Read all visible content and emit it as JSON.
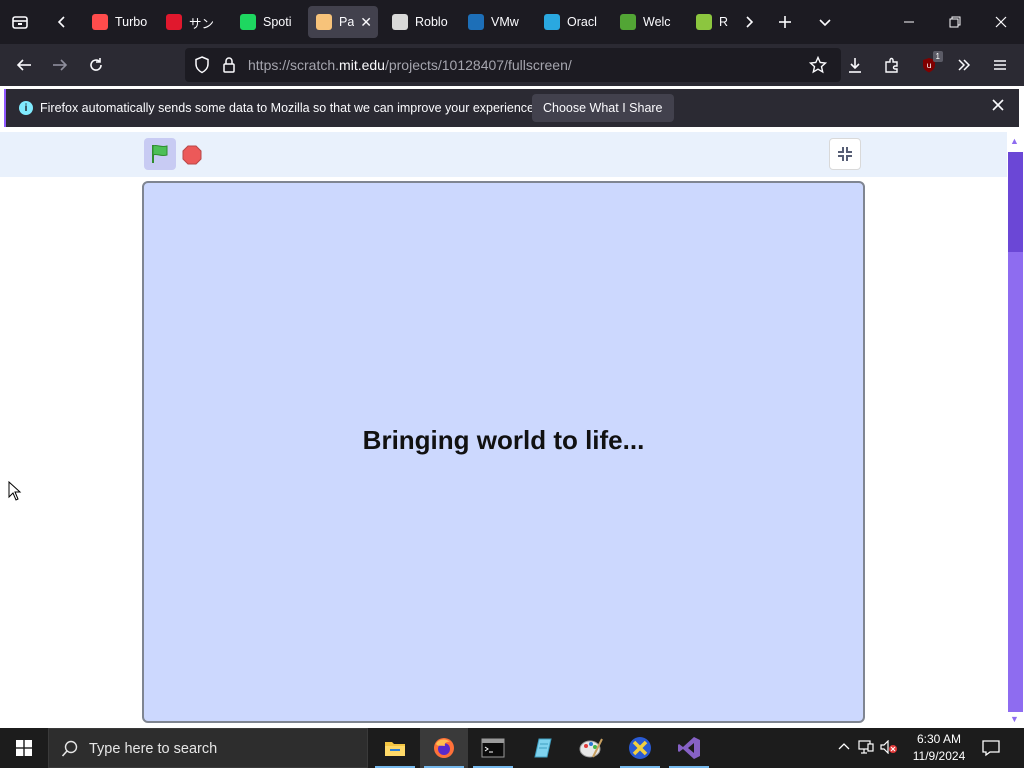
{
  "tabs": [
    {
      "label": "Turbo",
      "favicon": "turbowarp-icon",
      "color": "#ff4c4c"
    },
    {
      "label": "サン",
      "favicon": "sanrio-icon",
      "color": "#e0182d"
    },
    {
      "label": "Spoti",
      "favicon": "spotify-icon",
      "color": "#1ed760"
    },
    {
      "label": "Pa",
      "favicon": "scratch-page-icon",
      "color": "#f7c37a",
      "active": true
    },
    {
      "label": "Roblo",
      "favicon": "roblox-icon",
      "color": "#d9d9d9"
    },
    {
      "label": "VMw",
      "favicon": "vmware-icon",
      "color": "#1d6fb8"
    },
    {
      "label": "Oracl",
      "favicon": "oracle-icon",
      "color": "#2aa8e0"
    },
    {
      "label": "Welc",
      "favicon": "minecraft-icon",
      "color": "#52a535"
    },
    {
      "label": "Rol",
      "favicon": "roblox-studio-icon",
      "color": "#8cc63f"
    }
  ],
  "navbar": {
    "url_prefix": "https://scratch.",
    "url_host": "mit.edu",
    "url_suffix": "/projects/10128407/fullscreen/",
    "extension_badge": "1"
  },
  "notification": {
    "message": "Firefox automatically sends some data to Mozilla so that we can improve your experience.",
    "button_label": "Choose What I Share"
  },
  "stage": {
    "message": "Bringing world to life..."
  },
  "taskbar": {
    "search_placeholder": "Type here to search",
    "time": "6:30 AM",
    "date": "11/9/2024"
  },
  "colors": {
    "accent": "#9059ff",
    "stage_bg": "#ccd8fe",
    "controls_bg": "#e9f1fc",
    "scroll_thumb": "#6b47d6"
  }
}
